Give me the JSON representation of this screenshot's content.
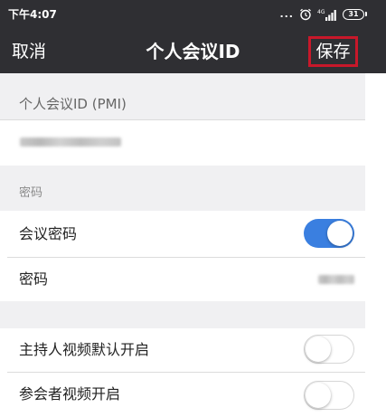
{
  "status_bar": {
    "time": "下午4:07",
    "dots": "...",
    "alarm_icon": "alarm-clock-icon",
    "signal_icon": "signal-4g-icon",
    "battery": "31"
  },
  "nav": {
    "cancel_label": "取消",
    "title": "个人会议ID",
    "save_label": "保存",
    "save_highlight_color": "#c8182a",
    "background_color": "#2f2f33"
  },
  "pmi": {
    "header": "个人会议ID (PMI)"
  },
  "password_section": {
    "header": "密码",
    "meeting_password": {
      "label": "会议密码",
      "enabled": true
    },
    "password": {
      "label": "密码"
    }
  },
  "video_section": {
    "host_video": {
      "label": "主持人视频默认开启",
      "enabled": false
    },
    "participant_video": {
      "label": "参会者视频开启",
      "enabled": false
    }
  },
  "colors": {
    "toggle_on": "#3a7fe0",
    "section_background": "#f0f0f2"
  }
}
